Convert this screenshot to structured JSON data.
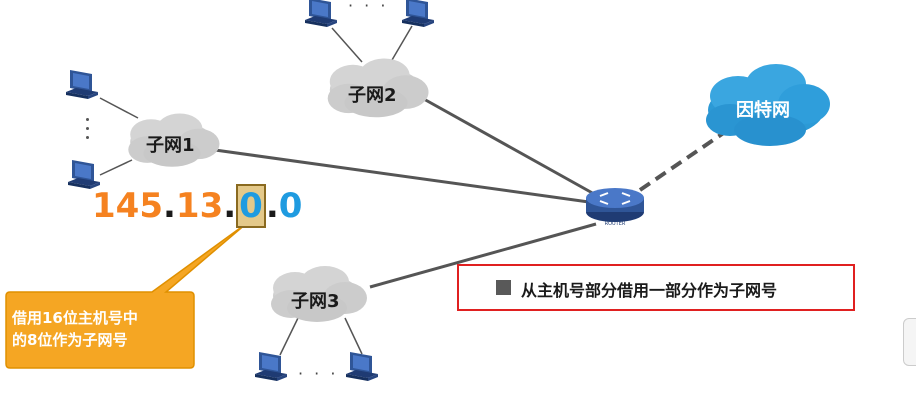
{
  "subnets": {
    "subnet1": "子网1",
    "subnet2": "子网2",
    "subnet3": "子网3"
  },
  "internet": "因特网",
  "router": {
    "label": "ROUTER"
  },
  "ip_address": {
    "part1": "145",
    "sep1": ".",
    "part2": "13",
    "sep2": ".",
    "part3": "0",
    "sep3": ".",
    "part4": "0"
  },
  "callout": {
    "line1": "借用16位主机号中",
    "line2": "的8位作为子网号"
  },
  "note": "从主机号部分借用一部分作为子网号",
  "ellipsis": "· · ·",
  "colors": {
    "network_part": "#f58220",
    "subnet_host_part": "#1f9be0",
    "callout_fill": "#f5a623",
    "internet_cloud": "#2c9ad6",
    "note_border": "#e02020"
  }
}
